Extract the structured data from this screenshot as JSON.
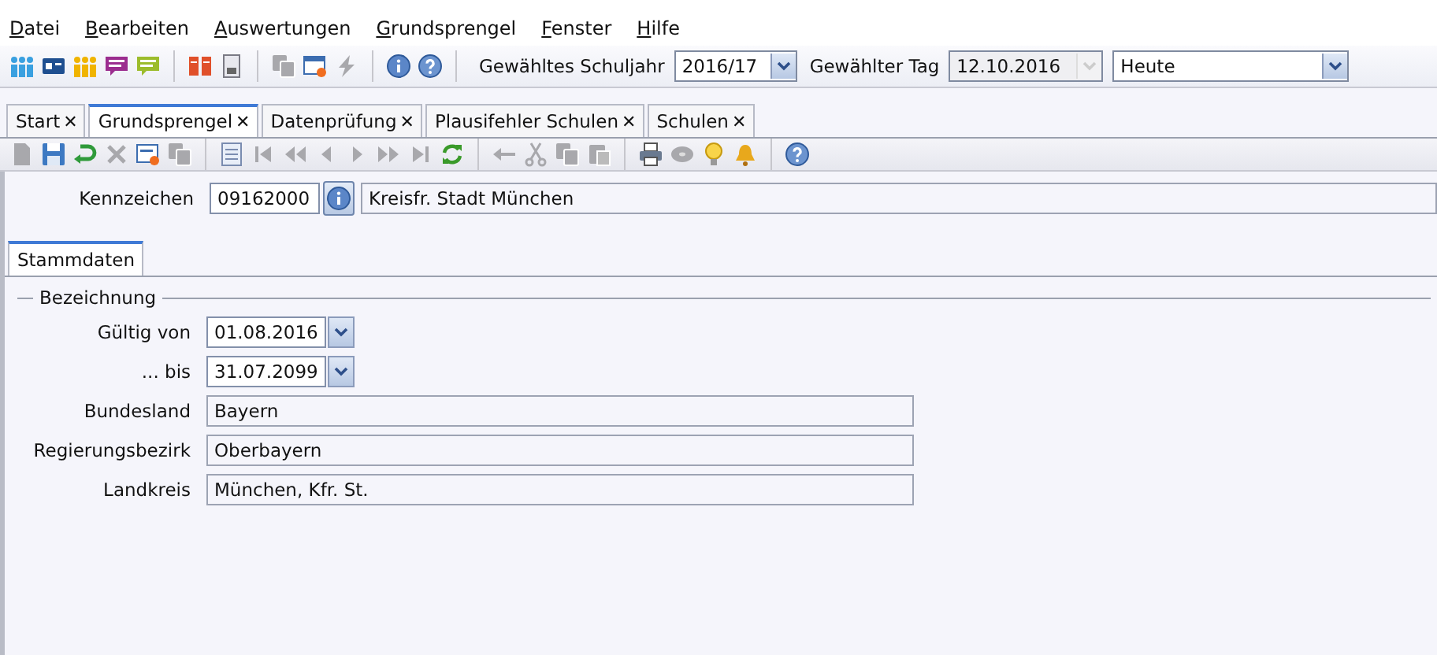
{
  "menu": [
    {
      "label": "Datei"
    },
    {
      "label": "Bearbeiten"
    },
    {
      "label": "Auswertungen"
    },
    {
      "label": "Grundsprengel"
    },
    {
      "label": "Fenster"
    },
    {
      "label": "Hilfe"
    }
  ],
  "selectors": {
    "schuljahr": {
      "label": "Gewähltes Schuljahr",
      "value": "2016/17"
    },
    "tag": {
      "label": "Gewählter Tag",
      "value": "12.10.2016",
      "disabled": true
    },
    "mode": {
      "value": "Heute"
    }
  },
  "tabs": [
    {
      "label": "Start",
      "close": "✕",
      "selected": false
    },
    {
      "label": "Grundsprengel",
      "close": "✕",
      "selected": true
    },
    {
      "label": "Datenprüfung",
      "close": "✕",
      "selected": false
    },
    {
      "label": "Plausifehler Schulen",
      "close": "✕",
      "selected": false
    },
    {
      "label": "Schulen",
      "close": "✕",
      "selected": false
    }
  ],
  "record": {
    "label": "Kennzeichen",
    "value": "09162000",
    "name": "Kreisfr. Stadt München"
  },
  "subtabs": [
    {
      "label": "Stammdaten",
      "selected": true
    }
  ],
  "group": {
    "title": "Bezeichnung",
    "fields": [
      {
        "label": "Gültig von",
        "value": "01.08.2016",
        "kind": "date"
      },
      {
        "label": "... bis",
        "value": "31.07.2099",
        "kind": "date"
      },
      {
        "label": "Bundesland",
        "value": "Bayern",
        "kind": "text"
      },
      {
        "label": "Regierungsbezirk",
        "value": "Oberbayern",
        "kind": "text"
      },
      {
        "label": "Landkreis",
        "value": "München, Kfr. St.",
        "kind": "text"
      }
    ]
  }
}
